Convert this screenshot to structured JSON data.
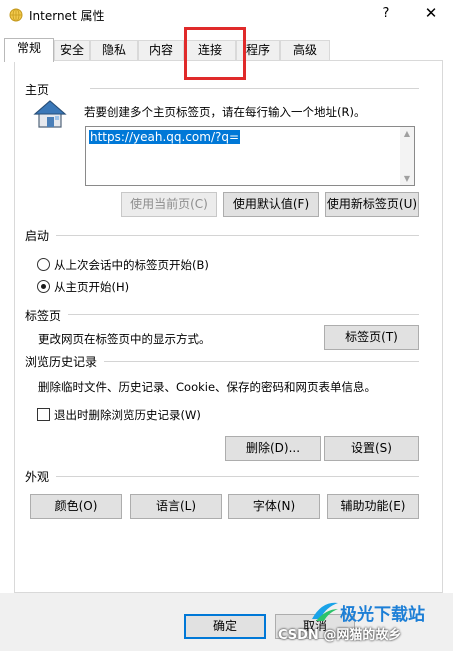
{
  "window": {
    "title": "Internet 属性",
    "help_glyph": "?",
    "close_glyph": "✕"
  },
  "tabs": [
    {
      "label": "常规"
    },
    {
      "label": "安全"
    },
    {
      "label": "隐私"
    },
    {
      "label": "内容"
    },
    {
      "label": "连接"
    },
    {
      "label": "程序"
    },
    {
      "label": "高级"
    }
  ],
  "homepage": {
    "group_label": "主页",
    "instruction": "若要创建多个主页标签页，请在每行输入一个地址(R)。",
    "url_value": "https://yeah.qq.com/?q=",
    "buttons": {
      "use_current": "使用当前页(C)",
      "use_default": "使用默认值(F)",
      "use_new_tab": "使用新标签页(U)"
    }
  },
  "startup": {
    "group_label": "启动",
    "option_last_session": "从上次会话中的标签页开始(B)",
    "option_homepage": "从主页开始(H)"
  },
  "tabs_section": {
    "group_label": "标签页",
    "description": "更改网页在标签页中的显示方式。",
    "button": "标签页(T)"
  },
  "history": {
    "group_label": "浏览历史记录",
    "description": "删除临时文件、历史记录、Cookie、保存的密码和网页表单信息。",
    "checkbox_label": "退出时删除浏览历史记录(W)",
    "delete_button": "删除(D)...",
    "settings_button": "设置(S)"
  },
  "appearance": {
    "group_label": "外观",
    "colors_button": "颜色(O)",
    "languages_button": "语言(L)",
    "fonts_button": "字体(N)",
    "accessibility_button": "辅助功能(E)"
  },
  "footer": {
    "ok_button": "确定",
    "cancel_button": "取消"
  },
  "watermarks": {
    "brand": "极光下载站",
    "credit": "CSDN @网猫的故乡"
  },
  "colors": {
    "accent": "#0078d7",
    "highlight_box": "#e02a2a"
  }
}
